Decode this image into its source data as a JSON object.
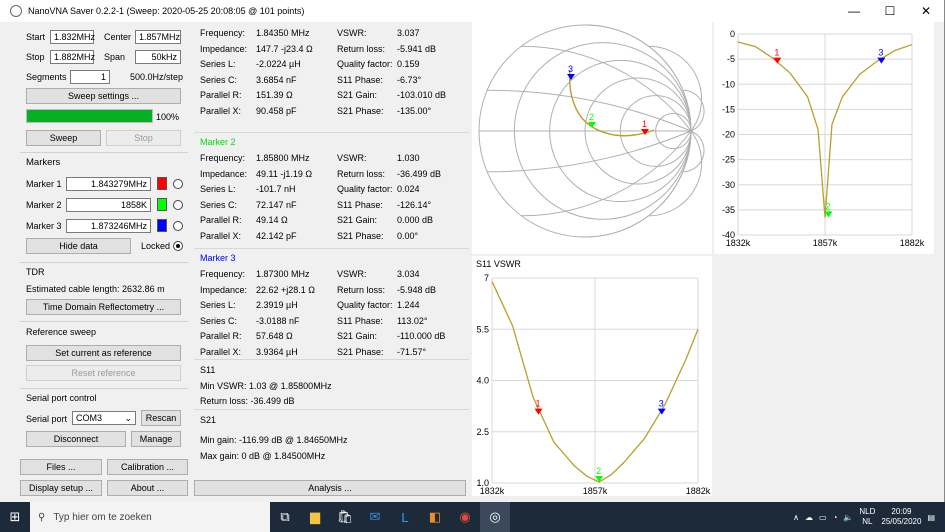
{
  "window": {
    "title": "NanoVNA Saver 0.2.2-1 (Sweep: 2020-05-25 20:08:05 @ 101 points)"
  },
  "sweep": {
    "start_label": "Start",
    "start_value": "1.832MHz",
    "center_label": "Center",
    "center_value": "1.857MHz",
    "stop_label": "Stop",
    "stop_value": "1.882MHz",
    "span_label": "Span",
    "span_value": "50kHz",
    "segments_label": "Segments",
    "segments_value": "1",
    "step_text": "500.0Hz/step",
    "settings_button": "Sweep settings ...",
    "progress": 100,
    "progress_text": "100%",
    "sweep_button": "Sweep",
    "stop_button": "Stop"
  },
  "markers_panel": {
    "title": "Markers",
    "items": [
      {
        "label": "Marker 1",
        "value": "1.843279MHz",
        "color": "#ff0000"
      },
      {
        "label": "Marker 2",
        "value": "1858K",
        "color": "#00ff00"
      },
      {
        "label": "Marker 3",
        "value": "1.873246MHz",
        "color": "#0000ff"
      }
    ],
    "hide_button": "Hide data",
    "locked_label": "Locked"
  },
  "tdr": {
    "title": "TDR",
    "length_text": "Estimated cable length: 2632.86 m",
    "button": "Time Domain Reflectometry ..."
  },
  "reference": {
    "title": "Reference sweep",
    "set_button": "Set current as reference",
    "reset_button": "Reset reference"
  },
  "serial": {
    "title": "Serial port control",
    "port_label": "Serial port",
    "port_value": "COM3",
    "rescan_button": "Rescan",
    "disconnect_button": "Disconnect",
    "manage_button": "Manage"
  },
  "bottom_buttons": {
    "files": "Files ...",
    "calibration": "Calibration ...",
    "display": "Display setup ...",
    "about": "About ...",
    "analysis": "Analysis ..."
  },
  "marker_details": [
    {
      "name": "",
      "color": "#000000",
      "left": [
        [
          "Frequency:",
          "1.84350 MHz"
        ],
        [
          "Impedance:",
          "147.7 -j23.4 Ω"
        ],
        [
          "Series L:",
          "-2.0224 µH"
        ],
        [
          "Series C:",
          "3.6854 nF"
        ],
        [
          "Parallel R:",
          "151.39 Ω"
        ],
        [
          "Parallel X:",
          "90.458 pF"
        ]
      ],
      "right": [
        [
          "VSWR:",
          "3.037"
        ],
        [
          "Return loss:",
          "-5.941 dB"
        ],
        [
          "Quality factor:",
          "0.159"
        ],
        [
          "S11 Phase:",
          "-6.73°"
        ],
        [
          "S21 Gain:",
          "-103.010 dB"
        ],
        [
          "S21 Phase:",
          "-135.00°"
        ]
      ]
    },
    {
      "name": "Marker 2",
      "color": "#00dd00",
      "left": [
        [
          "Frequency:",
          "1.85800 MHz"
        ],
        [
          "Impedance:",
          "49.11 -j1.19 Ω"
        ],
        [
          "Series L:",
          "-101.7 nH"
        ],
        [
          "Series C:",
          "72.147 nF"
        ],
        [
          "Parallel R:",
          "49.14 Ω"
        ],
        [
          "Parallel X:",
          "42.142 pF"
        ]
      ],
      "right": [
        [
          "VSWR:",
          "1.030"
        ],
        [
          "Return loss:",
          "-36.499 dB"
        ],
        [
          "Quality factor:",
          "0.024"
        ],
        [
          "S11 Phase:",
          "-126.14°"
        ],
        [
          "S21 Gain:",
          "0.000 dB"
        ],
        [
          "S21 Phase:",
          "0.00°"
        ]
      ]
    },
    {
      "name": "Marker 3",
      "color": "#0000ff",
      "left": [
        [
          "Frequency:",
          "1.87300 MHz"
        ],
        [
          "Impedance:",
          "22.62 +j28.1 Ω"
        ],
        [
          "Series L:",
          "2.3919 µH"
        ],
        [
          "Series C:",
          "-3.0188 nF"
        ],
        [
          "Parallel R:",
          "57.648 Ω"
        ],
        [
          "Parallel X:",
          "3.9364 µH"
        ]
      ],
      "right": [
        [
          "VSWR:",
          "3.034"
        ],
        [
          "Return loss:",
          "-5.948 dB"
        ],
        [
          "Quality factor:",
          "1.244"
        ],
        [
          "S11 Phase:",
          "113.02°"
        ],
        [
          "S21 Gain:",
          "-110.000 dB"
        ],
        [
          "S21 Phase:",
          "-71.57°"
        ]
      ]
    }
  ],
  "s11_summary": {
    "title": "S11",
    "min_vswr": "Min VSWR:  1.03 @ 1.85800MHz",
    "return_loss": "Return loss:  -36.499 dB"
  },
  "s21_summary": {
    "title": "S21",
    "min_gain": "Min gain:  -116.99 dB @ 1.84650MHz",
    "max_gain": "Max gain:  0 dB @ 1.84500MHz"
  },
  "chart_data": [
    {
      "type": "smith",
      "title": "",
      "markers": [
        "1",
        "2",
        "3"
      ]
    },
    {
      "type": "line",
      "title": "",
      "x_ticks": [
        "1832k",
        "1857k",
        "1882k"
      ],
      "y_ticks": [
        "0",
        "-5",
        "-10",
        "-15",
        "-20",
        "-25",
        "-30",
        "-35",
        "-40"
      ],
      "ylim": [
        -40,
        0
      ],
      "xlim": [
        1832,
        1882
      ],
      "series": [
        {
          "x": [
            1832,
            1837,
            1842,
            1847,
            1852,
            1855,
            1857,
            1859,
            1862,
            1867,
            1872,
            1877,
            1882
          ],
          "y": [
            -1.6,
            -2.5,
            -4.8,
            -7.8,
            -12.5,
            -19,
            -36.5,
            -18,
            -12.5,
            -8,
            -5.4,
            -3.3,
            -2.1
          ]
        }
      ],
      "markers": [
        {
          "label": "1",
          "x": 1843.3,
          "y": -5.9,
          "color": "#ff0000"
        },
        {
          "label": "2",
          "x": 1858.0,
          "y": -36.5,
          "color": "#00ff00"
        },
        {
          "label": "3",
          "x": 1873.2,
          "y": -5.9,
          "color": "#0000ff"
        }
      ]
    },
    {
      "type": "line",
      "title": "S11 VSWR",
      "x_ticks": [
        "1832k",
        "1857k",
        "1882k"
      ],
      "y_ticks": [
        "7",
        "5.5",
        "4.0",
        "2.5",
        "1.0"
      ],
      "ylim": [
        1.0,
        7.0
      ],
      "xlim": [
        1832,
        1882
      ],
      "series": [
        {
          "x": [
            1832,
            1837,
            1842,
            1847,
            1852,
            1855,
            1858,
            1861,
            1864,
            1869,
            1874,
            1879,
            1882
          ],
          "y": [
            6.9,
            5.6,
            3.5,
            2.2,
            1.5,
            1.2,
            1.03,
            1.25,
            1.6,
            2.3,
            3.3,
            4.6,
            5.5
          ]
        }
      ],
      "markers": [
        {
          "label": "1",
          "x": 1843.3,
          "y": 3.0,
          "color": "#ff0000"
        },
        {
          "label": "2",
          "x": 1858.0,
          "y": 1.03,
          "color": "#00ff00"
        },
        {
          "label": "3",
          "x": 1873.2,
          "y": 3.0,
          "color": "#0000ff"
        }
      ]
    }
  ],
  "taskbar": {
    "search_placeholder": "Typ hier om te zoeken",
    "lang": "NLD",
    "lang2": "NL",
    "time": "20:09",
    "date": "25/05/2020"
  }
}
